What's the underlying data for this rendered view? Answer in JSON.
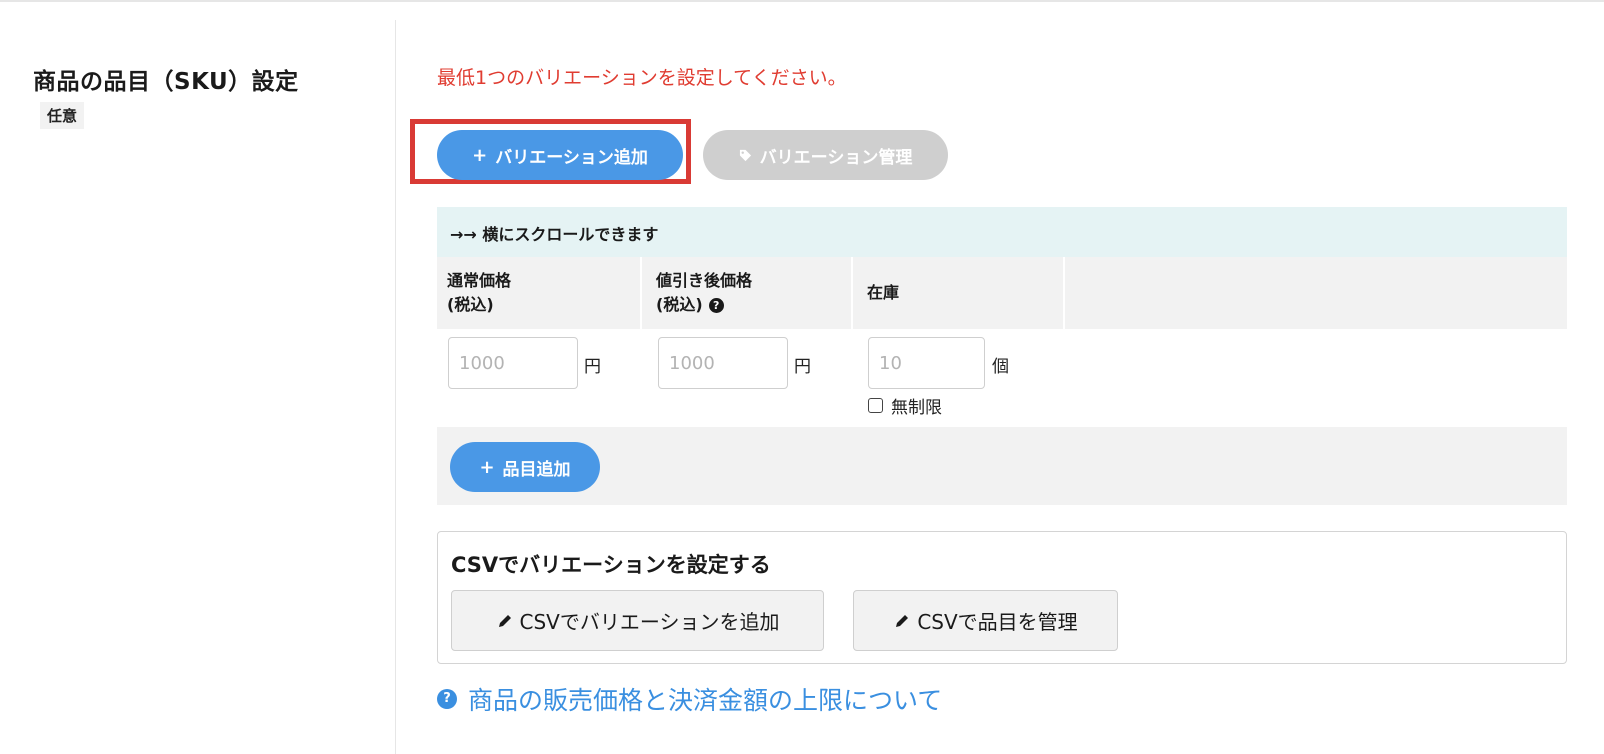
{
  "section": {
    "title": "商品の品目（SKU）設定",
    "optional_badge": "任意"
  },
  "error_message": "最低1つのバリエーションを設定してください。",
  "actions": {
    "add_variation": {
      "icon": "plus-icon",
      "plus": "+",
      "label": "バリエーション追加"
    },
    "manage_variation": {
      "icon": "tag-icon",
      "label": "バリエーション管理"
    }
  },
  "scroll_hint": "→→ 横にスクロールできます",
  "table": {
    "headers": [
      {
        "line1": "通常価格",
        "line2": "(税込)"
      },
      {
        "line1": "値引き後価格",
        "line2": "(税込)",
        "icon": "question-circle-icon"
      },
      {
        "line1": "在庫"
      }
    ],
    "row": {
      "regular_price": {
        "value": "",
        "placeholder": "1000",
        "unit": "円"
      },
      "sale_price": {
        "value": "",
        "placeholder": "1000",
        "unit": "円"
      },
      "stock": {
        "value": "",
        "placeholder": "10",
        "unit": "個"
      },
      "unlimited": {
        "label": "無制限",
        "checked": false
      }
    }
  },
  "add_item": {
    "plus": "+",
    "label": "品目追加"
  },
  "csv": {
    "title": "CSVでバリエーションを設定する",
    "add_button": {
      "icon": "pencil-icon",
      "label": "CSVでバリエーションを追加"
    },
    "manage_button": {
      "icon": "pencil-icon",
      "label": "CSVで品目を管理"
    }
  },
  "info_link": {
    "icon": "question-circle-icon",
    "label": "商品の販売価格と決済金額の上限について"
  },
  "colors": {
    "primary": "#4a98e6",
    "disabled": "#cfcfcf",
    "error": "#e03c31",
    "highlight": "#d93a35",
    "link": "#3a8fe0",
    "hint_bg": "#e5f3f4"
  }
}
